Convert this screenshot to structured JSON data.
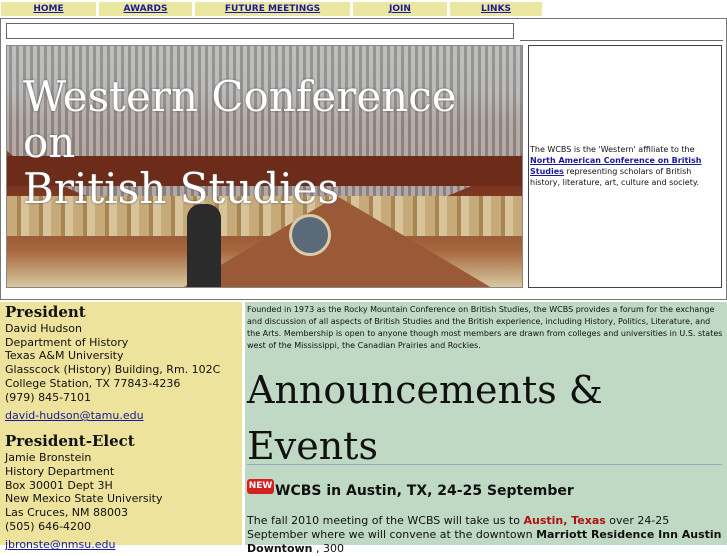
{
  "nav": {
    "items": [
      {
        "label": "HOME"
      },
      {
        "label": "AWARDS"
      },
      {
        "label": "FUTURE MEETINGS"
      },
      {
        "label": "JOIN"
      },
      {
        "label": "LINKS"
      }
    ]
  },
  "banner": {
    "title_line1": "Western Conference on",
    "title_line2": "British Studies"
  },
  "about": {
    "text_before": "The WCBS is the 'Western' affiliate to the ",
    "link": "North American Conference on British Studies",
    "text_after": " representing scholars of British history, literature, art, culture and society."
  },
  "officers": [
    {
      "role": "President",
      "lines": [
        "David Hudson",
        "Department of History",
        "Texas A&M University",
        "Glasscock (History) Building, Rm. 102C",
        "College Station, TX  77843-4236",
        "(979) 845-7101"
      ],
      "email": "david-hudson@tamu.edu"
    },
    {
      "role": "President-Elect",
      "lines": [
        "Jamie Bronstein",
        "History Department",
        "Box 30001 Dept 3H",
        "New Mexico State University",
        "Las Cruces, NM 88003",
        "(505) 646-4200"
      ],
      "email": "jbronste@nmsu.edu"
    }
  ],
  "intro": "Founded in 1973 as the Rocky Mountain Conference on British Studies, the WCBS provides a forum for the exchange and discussion of all aspects of British Studies and the British experience, including History, Politics, Literature, and the Arts. Membership is open to anyone though most members are drawn from colleges and universities in U.S. states west of the Mississippi, the Canadian Prairies and Rockies.",
  "announcements": {
    "heading": "Announcements & Events",
    "badge": "NEW",
    "event_title": "WCBS in Austin, TX, 24-25 September",
    "body_1": "The fall 2010 meeting of the WCBS will take us to ",
    "body_city": "Austin, Texas",
    "body_2": " over 24-25 September where we will convene at the downtown ",
    "body_venue": "Marriott Residence Inn Austin Downtown",
    "body_3": " , 300"
  },
  "colors": {
    "nav_bg": "#ece7a0",
    "left_bg": "#ede39c",
    "right_bg": "#bfd9c4",
    "link": "#1a1a99",
    "accent": "#b01010"
  }
}
